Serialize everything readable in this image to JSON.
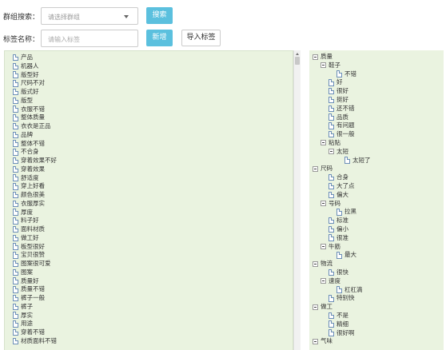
{
  "filters": {
    "group_label": "群组搜索：",
    "group_placeholder": "请选择群组",
    "search_button": "搜索",
    "tag_label": "标签名称：",
    "tag_placeholder": "请输入标签",
    "add_button": "新增",
    "import_button": "导入标签"
  },
  "left_list": [
    "产品",
    "机器人",
    "版型好",
    "尺码不对",
    "版式好",
    "版型",
    "衣服不错",
    "整体质量",
    "衣衣是正品",
    "品牌",
    "整体不错",
    "不合身",
    "穿着效果不好",
    "穿着效果",
    "舒适度",
    "穿上好看",
    "颜色很美",
    "衣服厚实",
    "厚度",
    "料子好",
    "面料材质",
    "做工好",
    "板型很好",
    "宝贝很赞",
    "图案很可爱",
    "图案",
    "质量好",
    "质量不错",
    "裤子一般",
    "裤子",
    "厚实",
    "用途",
    "穿着不错",
    "材质面料不错"
  ],
  "right_tree": [
    {
      "type": "folder",
      "level": 0,
      "label": "质量"
    },
    {
      "type": "folder",
      "level": 1,
      "label": "鞋子"
    },
    {
      "type": "doc",
      "level": 3,
      "label": "不错"
    },
    {
      "type": "doc",
      "level": 2,
      "label": "好"
    },
    {
      "type": "doc",
      "level": 2,
      "label": "很好"
    },
    {
      "type": "doc",
      "level": 2,
      "label": "挺好"
    },
    {
      "type": "doc",
      "level": 2,
      "label": "还不错"
    },
    {
      "type": "doc",
      "level": 2,
      "label": "品质"
    },
    {
      "type": "doc",
      "level": 2,
      "label": "有问题"
    },
    {
      "type": "doc",
      "level": 2,
      "label": "很一般"
    },
    {
      "type": "folder",
      "level": 1,
      "label": "粘贴"
    },
    {
      "type": "folder",
      "level": 2,
      "label": "太短"
    },
    {
      "type": "doc",
      "level": 4,
      "label": "太短了"
    },
    {
      "type": "folder",
      "level": 0,
      "label": "尺码"
    },
    {
      "type": "doc",
      "level": 2,
      "label": "合身"
    },
    {
      "type": "doc",
      "level": 2,
      "label": "大了点"
    },
    {
      "type": "doc",
      "level": 2,
      "label": "偏大"
    },
    {
      "type": "folder",
      "level": 1,
      "label": "号码"
    },
    {
      "type": "doc",
      "level": 3,
      "label": "拉黑"
    },
    {
      "type": "doc",
      "level": 2,
      "label": "标准"
    },
    {
      "type": "doc",
      "level": 2,
      "label": "偏小"
    },
    {
      "type": "doc",
      "level": 2,
      "label": "很准"
    },
    {
      "type": "folder",
      "level": 1,
      "label": "牛筋"
    },
    {
      "type": "doc",
      "level": 3,
      "label": "最大"
    },
    {
      "type": "folder",
      "level": 0,
      "label": "物流"
    },
    {
      "type": "doc",
      "level": 2,
      "label": "很快"
    },
    {
      "type": "folder",
      "level": 1,
      "label": "速度"
    },
    {
      "type": "doc",
      "level": 3,
      "label": "杠杠滴"
    },
    {
      "type": "doc",
      "level": 2,
      "label": "特别快"
    },
    {
      "type": "folder",
      "level": 0,
      "label": "做工"
    },
    {
      "type": "doc",
      "level": 2,
      "label": "不是"
    },
    {
      "type": "doc",
      "level": 2,
      "label": "精细"
    },
    {
      "type": "doc",
      "level": 2,
      "label": "很好啊"
    },
    {
      "type": "folder",
      "level": 0,
      "label": "气味"
    }
  ],
  "colors": {
    "primary_button": "#5bc0de",
    "panel_bg": "#eaf3e0"
  }
}
